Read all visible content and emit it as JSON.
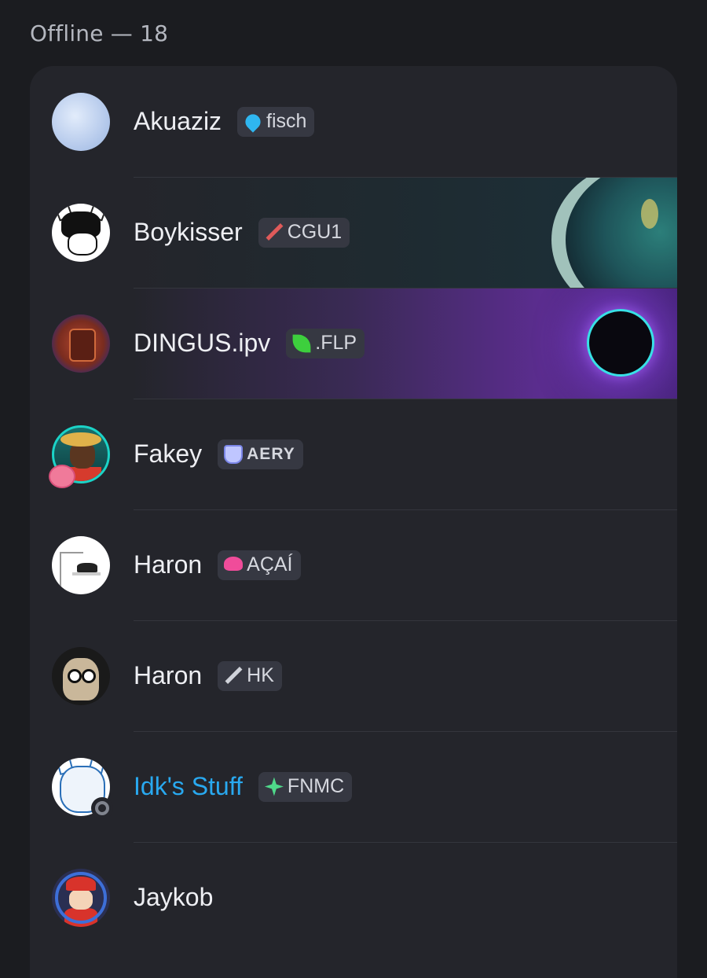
{
  "section": {
    "header": "Offline — 18"
  },
  "members": [
    {
      "name": "Akuaziz",
      "tag": "fisch",
      "tag_icon": "water-drop-icon",
      "avatar": "sky-clouds-avatar"
    },
    {
      "name": "Boykisser",
      "tag": "CGU1",
      "tag_icon": "red-sword-icon",
      "avatar": "anime-boy-cat-ears-avatar",
      "banner": "space-planet-banner"
    },
    {
      "name": "DINGUS.ipv",
      "tag": ".FLP",
      "tag_icon": "green-leaf-icon",
      "avatar": "tiki-mask-avatar",
      "banner": "purple-vortex-banner"
    },
    {
      "name": "Fakey",
      "tag": "AERY",
      "tag_icon": "crystal-icon",
      "avatar": "straw-hat-pixel-avatar"
    },
    {
      "name": "Haron",
      "tag": "AÇAÍ",
      "tag_icon": "pink-mushroom-icon",
      "avatar": "cat-on-shelf-avatar"
    },
    {
      "name": "Haron",
      "tag": "HK",
      "tag_icon": "silver-sword-icon",
      "avatar": "wide-eyed-cat-avatar"
    },
    {
      "name": "Idk's Stuff",
      "tag": "FNMC",
      "tag_icon": "green-sparkle-icon",
      "avatar": "sketch-cat-avatar",
      "status": "offline",
      "name_color": "#29a9f0"
    },
    {
      "name": "Jaykob",
      "tag": "",
      "avatar": "red-cap-headset-avatar"
    }
  ],
  "colors": {
    "background": "#1b1c20",
    "card": "#24252b",
    "tag_bg": "#363842",
    "accent_name": "#29a9f0"
  }
}
